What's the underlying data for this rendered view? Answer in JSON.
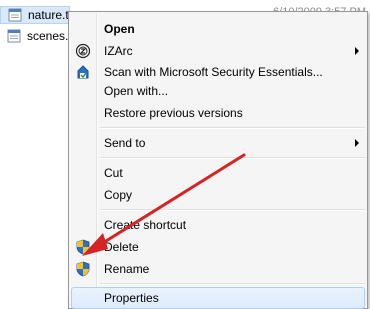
{
  "files": [
    {
      "name": "nature.t",
      "selected": true
    },
    {
      "name": "scenes.t",
      "selected": false
    }
  ],
  "file_date": "6/10/2009 3:57 PM",
  "context_menu": {
    "open": "Open",
    "izarc": "IZArc",
    "scan": "Scan with Microsoft Security Essentials...",
    "open_with": "Open with...",
    "restore": "Restore previous versions",
    "send_to": "Send to",
    "cut": "Cut",
    "copy": "Copy",
    "create_shortcut": "Create shortcut",
    "delete": "Delete",
    "rename": "Rename",
    "properties": "Properties"
  },
  "colors": {
    "annotation_arrow": "#d42424",
    "menu_background": "#f5f5f5",
    "selection_highlight": "#d9e9fb"
  }
}
